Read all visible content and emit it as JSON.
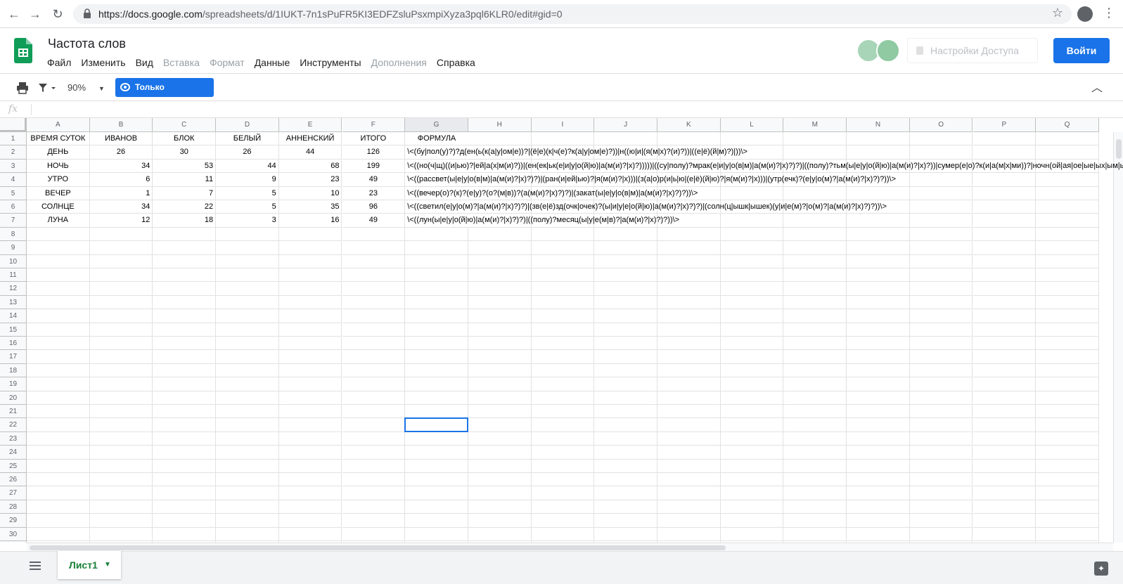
{
  "browser": {
    "url_main": "https://docs.google.com",
    "url_path": "/spreadsheets/d/1IUKT-7n1sPuFR5KI3EDFZsluPsxmpiXyza3pql6KLR0/edit#gid=0"
  },
  "header": {
    "title": "Частота слов",
    "menu": [
      "Файл",
      "Изменить",
      "Вид",
      "Вставка",
      "Формат",
      "Данные",
      "Инструменты",
      "Дополнения",
      "Справка"
    ],
    "menu_disabled": [
      false,
      false,
      false,
      true,
      true,
      false,
      false,
      true,
      false
    ],
    "share_label": "Настройки Доступа",
    "signin_label": "Войти"
  },
  "toolbar": {
    "zoom": "90%",
    "view_mode": "Только просмотр"
  },
  "formula_bar": {
    "fx": "fx",
    "value": ""
  },
  "grid": {
    "columns": [
      "A",
      "B",
      "C",
      "D",
      "E",
      "F",
      "G",
      "H",
      "I",
      "J",
      "K",
      "L",
      "M",
      "N",
      "O",
      "P",
      "Q"
    ],
    "selected_column": "G",
    "selected_cell": "G22",
    "visible_rows": 31,
    "rows": [
      [
        "ВРЕМЯ СУТОК",
        "ИВАНОВ",
        "БЛОК",
        "БЕЛЫЙ",
        "АННЕНСКИЙ",
        "ИТОГО",
        "ФОРМУЛА"
      ],
      [
        "ДЕНЬ",
        "26",
        "30",
        "26",
        "44",
        "126",
        "\\<(бу|пол(у)?)?д(ен(ь(к(а|у|ом|е))?|(ё|е)(к|ч(е)?к(а|у|ом|е)?))|н((ю|и|(я(м|х)?(и)?))|((е|ё)(й|м)?)|))\\>"
      ],
      [
        "НОЧЬ",
        "34",
        "53",
        "44",
        "68",
        "199",
        "\\<((но(ч|щ)((и|ью)?|ей|а(х|м(и)?))|(ен(ек|ьк(е|и|у|о(й|ю)|а(м(и)?|х)?)))))|((су|полу)?мрак(е|и|у|о(в|м)|а(м(и)?|х)?)?)|((полу)?тьм(ы|е|у|о(й|ю)|а(м(и)?|х)?))|сумер(е|о)?к(и|а(м|х|ми))?|ночн(ой|ая|ое|ые|ых|ым|ыми|ую|ого|ому|ом)?)\\>"
      ],
      [
        "УТРО",
        "6",
        "11",
        "9",
        "23",
        "49",
        "\\<((рассвет(ы|е|у|о(в|м)|а(м(и)?|х)?)?)|(ран(и|ей|ью)?|я(м(и)?|х)))|(з(а|о)р(и|ь|ю|(е|ё)(й|ю)?|я(м(и)?|х)))|(утр(ечк)?(е|у|о(м)?|а(м(и)?|х)?)?))\\>"
      ],
      [
        "ВЕЧЕР",
        "1",
        "7",
        "5",
        "10",
        "23",
        "\\<((вечер(о)?(к)?(е|у)?(о?(м|в))?(а(м(и)?|х)?)?)|(закат(ы|е|у|о(в|м)|а(м(и)?|х)?)?))\\>"
      ],
      [
        "СОЛНЦЕ",
        "34",
        "22",
        "5",
        "35",
        "96",
        "\\<((светил(е|у|о(м)?|а(м(и)?|х)?)?)|(зв(е|ё)зд(очк|очек)?(ы|и|у|е|о(й|ю)|а(м(и)?|х)?)?)|(солн(ц|ышк|ышек)(у|и|е(м)?|о(м)?|а(м(и)?|х)?)?))\\>"
      ],
      [
        "ЛУНА",
        "12",
        "18",
        "3",
        "16",
        "49",
        "\\<((лун(ы|е|у|о(й|ю)|а(м(и)?|х)?)?)|((полу)?месяц(ы|у|е(м|в)?|а(м(и)?|х)?)?))\\>"
      ]
    ]
  },
  "sheets": {
    "active_tab": "Лист1"
  },
  "colors": {
    "accent": "#1a73e8",
    "sheets_green": "#0f9d58",
    "tab_text": "#188038"
  }
}
